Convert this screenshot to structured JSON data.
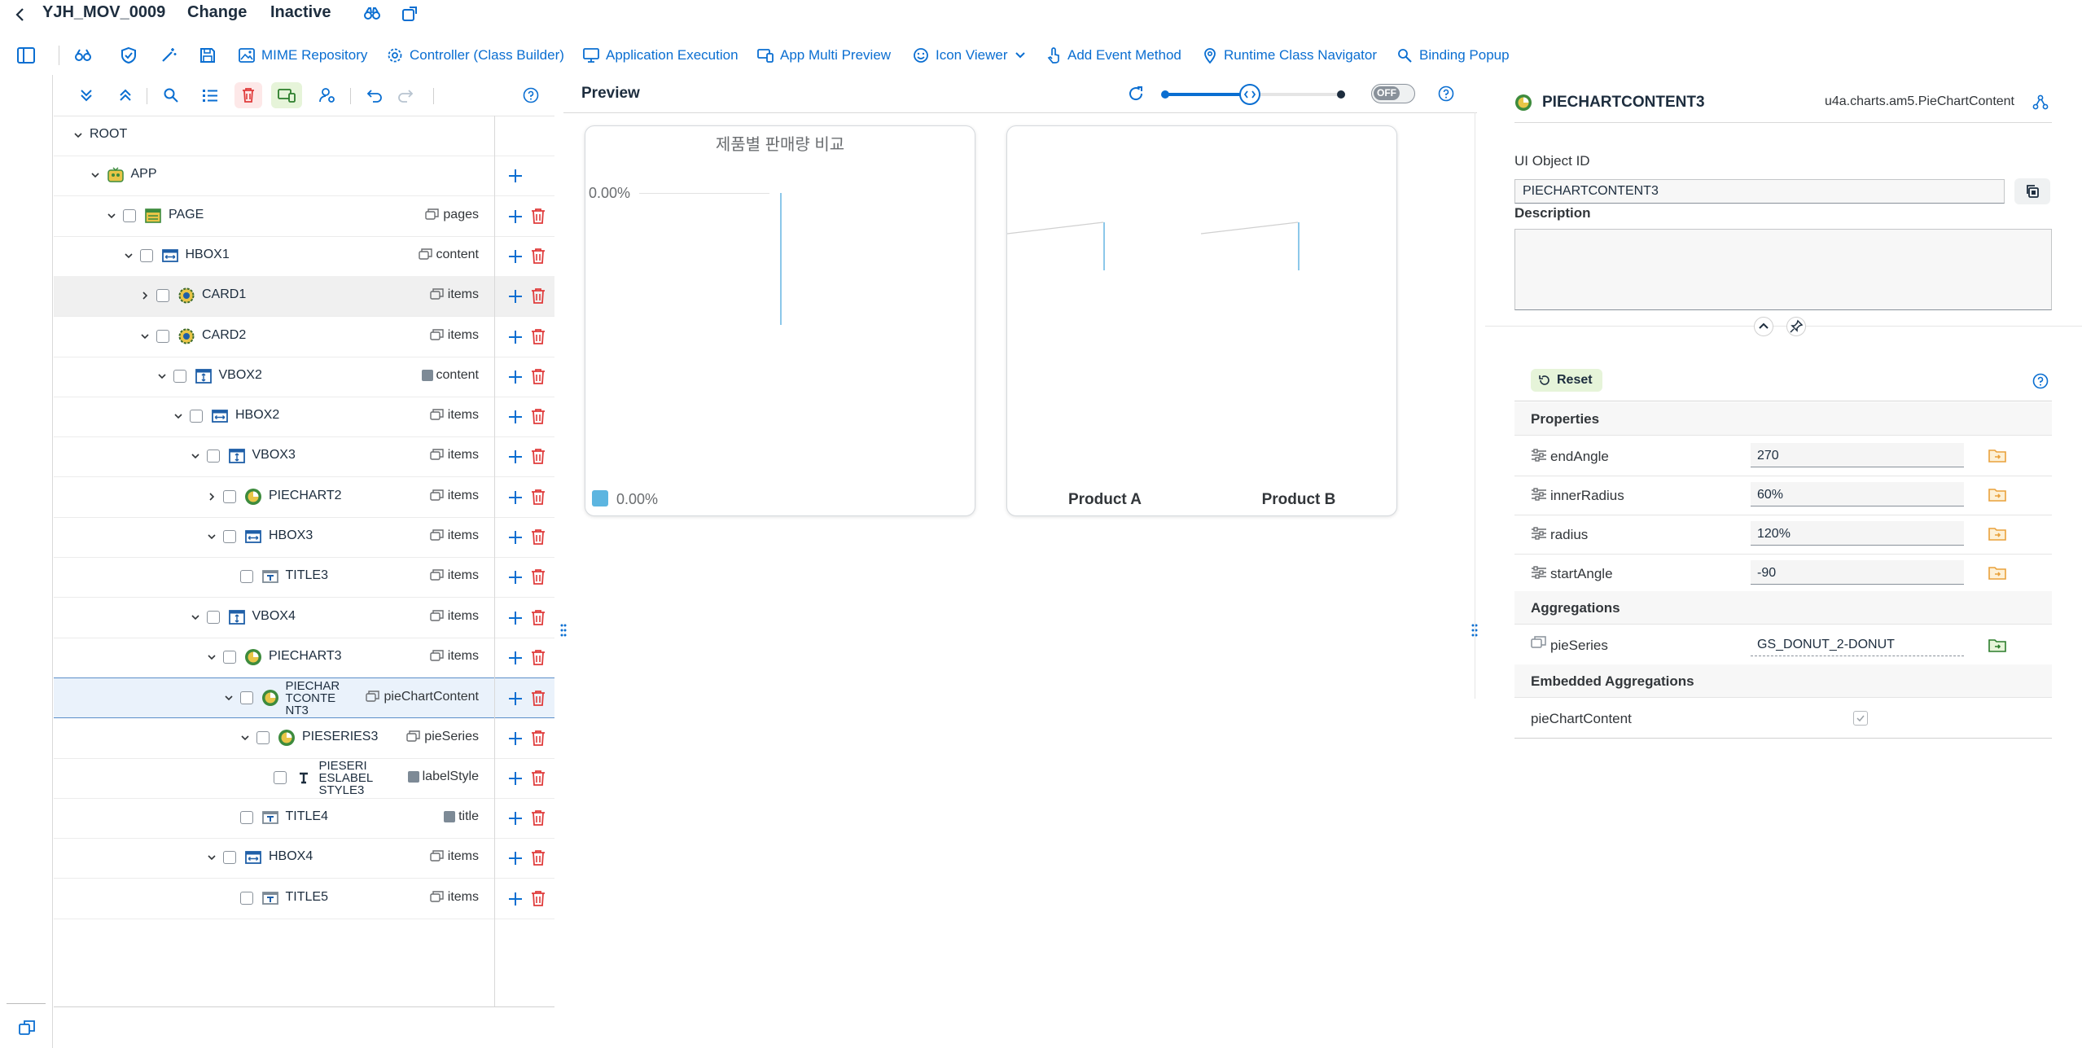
{
  "header": {
    "app_name": "YJH_MOV_0009",
    "mode": "Change",
    "status": "Inactive"
  },
  "toolbar": {
    "items": [
      {
        "label": "MIME Repository",
        "icon": "image-icon"
      },
      {
        "label": "Controller (Class Builder)",
        "icon": "settings-icon"
      },
      {
        "label": "Application Execution",
        "icon": "monitor-icon"
      },
      {
        "label": "App Multi Preview",
        "icon": "devices-icon"
      },
      {
        "label": "Icon Viewer",
        "icon": "smiley-icon"
      },
      {
        "label": "Add Event Method",
        "icon": "touch-icon"
      },
      {
        "label": "Runtime Class Navigator",
        "icon": "locate-icon"
      },
      {
        "label": "Binding Popup",
        "icon": "binding-icon"
      }
    ]
  },
  "tree": {
    "rows": [
      {
        "label": "ROOT",
        "agg": ""
      },
      {
        "label": "APP",
        "agg": ""
      },
      {
        "label": "PAGE",
        "agg": "pages"
      },
      {
        "label": "HBOX1",
        "agg": "content"
      },
      {
        "label": "CARD1",
        "agg": "items"
      },
      {
        "label": "CARD2",
        "agg": "items"
      },
      {
        "label": "VBOX2",
        "agg": "content"
      },
      {
        "label": "HBOX2",
        "agg": "items"
      },
      {
        "label": "VBOX3",
        "agg": "items"
      },
      {
        "label": "PIECHART2",
        "agg": "items"
      },
      {
        "label": "HBOX3",
        "agg": "items"
      },
      {
        "label": "TITLE3",
        "agg": "items"
      },
      {
        "label": "VBOX4",
        "agg": "items"
      },
      {
        "label": "PIECHART3",
        "agg": "items"
      },
      {
        "label": "PIECHARTCONTENT3",
        "agg": "pieChartContent"
      },
      {
        "label": "PIESERIES3",
        "agg": "pieSeries"
      },
      {
        "label": "PIESERIESLABELSTYLE3",
        "agg": "labelStyle"
      },
      {
        "label": "TITLE4",
        "agg": "title"
      },
      {
        "label": "HBOX4",
        "agg": "items"
      },
      {
        "label": "TITLE5",
        "agg": "items"
      }
    ]
  },
  "preview": {
    "title": "Preview",
    "toggle": "OFF",
    "card1": {
      "title": "제품별 판매량 비교",
      "axis_label": "0.00%",
      "legend_label": "0.00%",
      "legend_color": "#5cb5e0"
    },
    "card2": {
      "labels": [
        "Product A",
        "Product B"
      ]
    }
  },
  "props": {
    "object_name": "PIECHARTCONTENT3",
    "class_name": "u4a.charts.am5.PieChartContent",
    "ui_object_id_label": "UI Object ID",
    "ui_object_id": "PIECHARTCONTENT3",
    "description_label": "Description",
    "description": "",
    "reset_label": "Reset",
    "properties_title": "Properties",
    "properties": [
      {
        "name": "endAngle",
        "value": "270"
      },
      {
        "name": "innerRadius",
        "value": "60%"
      },
      {
        "name": "radius",
        "value": "120%"
      },
      {
        "name": "startAngle",
        "value": "-90"
      }
    ],
    "aggregations_title": "Aggregations",
    "aggregations": [
      {
        "name": "pieSeries",
        "value": "GS_DONUT_2-DONUT"
      }
    ],
    "embedded_title": "Embedded Aggregations",
    "embedded": [
      {
        "name": "pieChartContent"
      }
    ]
  },
  "colors": {
    "accent": "#0a6ed1",
    "delete": "#e03b3b",
    "folder": "#e9a13b",
    "bound": "#2b7d2b"
  }
}
